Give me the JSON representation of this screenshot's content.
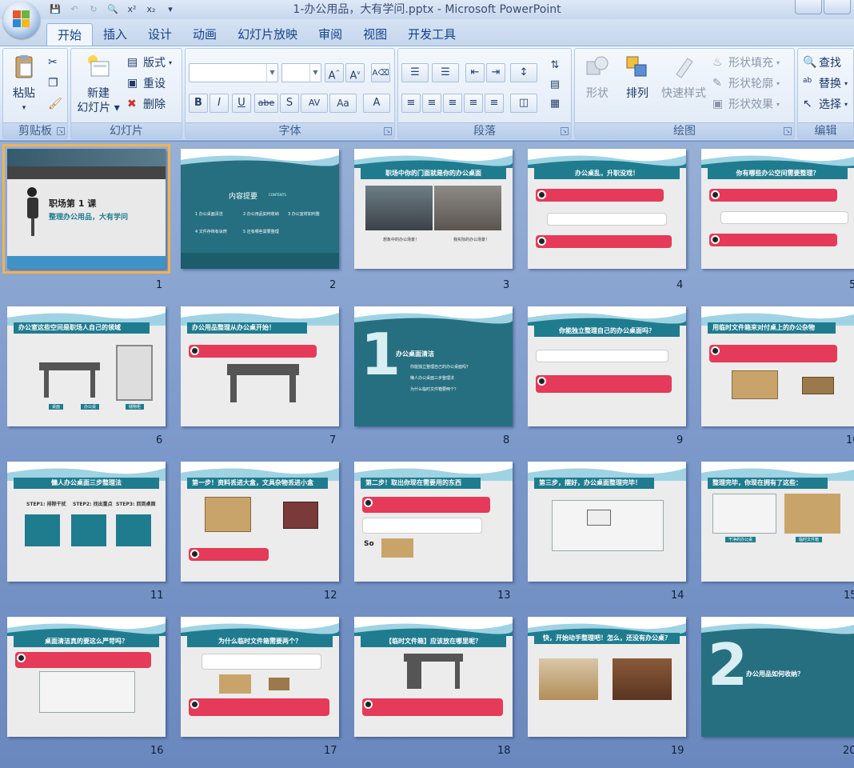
{
  "window": {
    "title": "1-办公用品，大有学问.pptx - Microsoft PowerPoint"
  },
  "tabs": [
    "开始",
    "插入",
    "设计",
    "动画",
    "幻灯片放映",
    "审阅",
    "视图",
    "开发工具"
  ],
  "ribbon": {
    "clipboard": {
      "label": "剪贴板",
      "paste": "粘贴"
    },
    "slides": {
      "label": "幻灯片",
      "new_slide": "新建",
      "new_slide2": "幻灯片",
      "layout": "版式",
      "reset": "重设",
      "delete": "删除"
    },
    "font": {
      "label": "字体",
      "bold": "B",
      "italic": "I",
      "underline": "U",
      "strike": "abe",
      "shadow": "S",
      "spacing": "AV",
      "case": "Aa",
      "color": "A"
    },
    "paragraph": {
      "label": "段落"
    },
    "drawing": {
      "label": "绘图",
      "shapes": "形状",
      "arrange": "排列",
      "quick_styles": "快速样式",
      "fill": "形状填充",
      "outline": "形状轮廓",
      "effects": "形状效果"
    },
    "editing": {
      "label": "编辑",
      "find": "查找",
      "replace": "替换",
      "select": "选择"
    }
  },
  "slides": [
    {
      "num": "1",
      "title": "职场第 1 课",
      "subtitle": "整理办公用品，大有学问"
    },
    {
      "num": "2",
      "title": "内容提要",
      "title_en": "CONTENTS",
      "items": [
        "1 办公桌面清洁",
        "2 办公用品如何收纳",
        "3 办公室材如何整",
        "4 文件存档有诀窍",
        "5 还有哪些需要整理"
      ]
    },
    {
      "num": "3",
      "title": "职场中你的门面就是你的办公桌面",
      "cap1": "想象中的办公场景！",
      "cap2": "我实际的办公场景！"
    },
    {
      "num": "4",
      "title": "办公桌乱，升职没戏！"
    },
    {
      "num": "5",
      "title": "你有哪些办公空间需要整理？"
    },
    {
      "num": "6",
      "title": "办公室这些空间是职场人自己的领域",
      "labels": [
        "桌面",
        "办公桌",
        "储物柜"
      ]
    },
    {
      "num": "7",
      "title": "办公用品整理从办公桌开始！"
    },
    {
      "num": "8",
      "big": "1",
      "title": "办公桌面清洁",
      "items": [
        "你能独立整理自己的办公桌面吗？",
        "懒人办公桌面三步整理法",
        "为什么临时文件箱要两个？"
      ]
    },
    {
      "num": "9",
      "title": "你能独立整理自己的办公桌面吗？"
    },
    {
      "num": "10",
      "title": "用临时文件箱来对付桌上的办公杂物"
    },
    {
      "num": "11",
      "title": "懒人办公桌面三步整理法",
      "steps": [
        "STEP1: 排除干扰",
        "STEP2: 找出重点",
        "STEP3: 回到桌面"
      ]
    },
    {
      "num": "12",
      "title": "第一步！资料丢进大盒，文具杂物丢进小盒"
    },
    {
      "num": "13",
      "title": "第二步！取出你现在需要用的东西",
      "so": "So"
    },
    {
      "num": "14",
      "title": "第三步，摆好，办公桌面整理完毕！"
    },
    {
      "num": "15",
      "title": "整理完毕，你现在拥有了这些：",
      "tags": [
        "干净的办公桌",
        "临时文件箱"
      ]
    },
    {
      "num": "16",
      "title": "桌面清洁真的要这么严苛吗？"
    },
    {
      "num": "17",
      "title": "为什么临时文件箱需要两个？"
    },
    {
      "num": "18",
      "title": "【临时文件箱】应该放在哪里呢？"
    },
    {
      "num": "19",
      "title": "快，开始动手整理吧！怎么，还没有办公桌？"
    },
    {
      "num": "20",
      "big": "2",
      "title": "办公用品如何收纳？"
    }
  ]
}
